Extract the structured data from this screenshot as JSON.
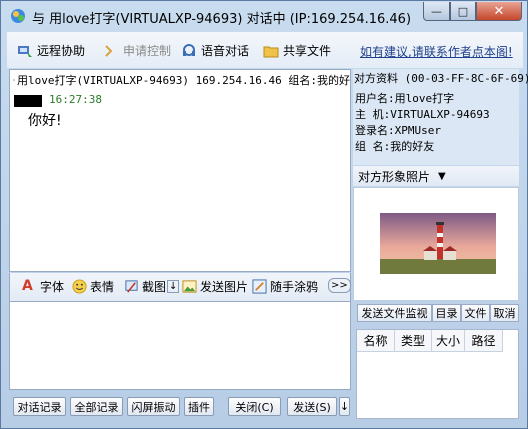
{
  "window": {
    "title": "与 用love打字(VIRTUALXP-94693) 对话中 (IP:169.254.16.46)",
    "controls": {
      "minimize": "—",
      "maximize": "□",
      "close": "✕"
    }
  },
  "toolbar": {
    "remote_assist": "远程协助",
    "request_control": "申请控制",
    "voice_chat": "语音对话",
    "share_files": "共享文件",
    "suggestion_link": "如有建议,请联系作者点本阁!"
  },
  "chat": {
    "header": "用love打字(VIRTUALXP-94693) 169.254.16.46 组名:我的好",
    "messages": [
      {
        "time": "16:27:38",
        "text": "你好!"
      }
    ]
  },
  "format_bar": {
    "font": "字体",
    "emoji": "表情",
    "screenshot": "截图",
    "screenshot_arrow": "↓",
    "send_image": "发送图片",
    "doodle": "随手涂鸦",
    "more": ">>"
  },
  "bottom": {
    "chat_log": "对话记录",
    "all_logs": "全部记录",
    "flash_shake": "闪屏振动",
    "plugins": "插件",
    "close": "关闭(C)",
    "send": "发送(S)",
    "send_arrow": "↓"
  },
  "profile": {
    "title": "对方资料 (00-03-FF-8C-6F-69)",
    "username": "用户名:用love打字",
    "host": "主  机:VIRTUALXP-94693",
    "login": "登录名:XPMUser",
    "group": "组  名:我的好友"
  },
  "photo": {
    "title": "对方形象照片",
    "arrow": "▼"
  },
  "files": {
    "tabs": [
      "发送文件监视",
      "目录",
      "文件",
      "取消"
    ],
    "columns": [
      "名称",
      "类型",
      "大小",
      "路径"
    ]
  },
  "colors": {
    "frame": "#c9dcef",
    "link": "#1e3f8a",
    "timestamp": "#2b7a2b",
    "close_button": "#c6462c"
  }
}
